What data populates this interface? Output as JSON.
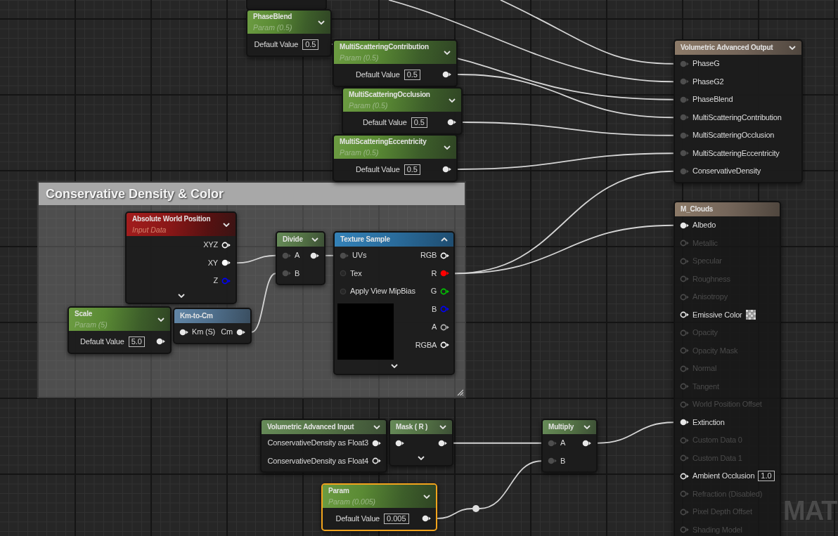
{
  "comment": {
    "title": "Conservative Density & Color"
  },
  "background_label": "MAT",
  "nodes": [
    {
      "kind": "parameter",
      "title": "PhaseBlend",
      "subtitle": "Param (0.5)",
      "selected": false,
      "preview": false,
      "outputs": [
        {
          "label": "Default Value",
          "value": "0.5"
        }
      ]
    },
    {
      "kind": "parameter",
      "title": "MultiScatteringContribution",
      "subtitle": "Param (0.5)",
      "selected": false,
      "preview": false,
      "outputs": [
        {
          "label": "Default Value",
          "value": "0.5",
          "kind": "filled"
        }
      ]
    },
    {
      "kind": "parameter",
      "title": "MultiScatteringOcclusion",
      "subtitle": "Param (0.5)",
      "selected": false,
      "preview": false,
      "outputs": [
        {
          "label": "Default Value",
          "value": "0.5",
          "kind": "filled"
        }
      ]
    },
    {
      "kind": "parameter",
      "title": "MultiScatteringEccentricity",
      "subtitle": "Param (0.5)",
      "selected": false,
      "preview": false,
      "outputs": [
        {
          "label": "Default Value",
          "value": "0.5",
          "kind": "filled"
        }
      ]
    },
    {
      "kind": "output",
      "title": "Volumetric Advanced Output",
      "selected": false,
      "preview": false,
      "inputs": [
        {
          "label": "PhaseG",
          "kind": "dim"
        },
        {
          "label": "PhaseG2",
          "kind": "dim"
        },
        {
          "label": "PhaseBlend",
          "kind": "dim"
        },
        {
          "label": "MultiScatteringContribution",
          "kind": "dim"
        },
        {
          "label": "MultiScatteringOcclusion",
          "kind": "dim"
        },
        {
          "label": "MultiScatteringEccentricity",
          "kind": "dim"
        },
        {
          "label": "ConservativeDensity",
          "kind": "dim"
        }
      ]
    },
    {
      "kind": "input_data",
      "title": "Absolute World Position",
      "subtitle": "Input Data",
      "selected": false,
      "preview": false,
      "expander": true,
      "outputs": [
        {
          "label": "XYZ",
          "kind": "hollow",
          "color": "#ffffff"
        },
        {
          "label": "XY",
          "kind": "filled",
          "color": "#ffffff"
        },
        {
          "label": "Z",
          "kind": "hollow",
          "color": "#0000ff"
        }
      ]
    },
    {
      "kind": "math",
      "title": "Divide",
      "selected": false,
      "preview": false,
      "inputs": [
        {
          "label": "A",
          "kind": "dim"
        },
        {
          "label": "B",
          "kind": "dim"
        }
      ],
      "outputs": [
        {
          "kind": "filled"
        }
      ]
    },
    {
      "kind": "texture",
      "title": "Texture Sample",
      "selected": false,
      "preview": true,
      "expander": true,
      "inputs": [
        {
          "label": "UVs",
          "kind": "dim"
        },
        {
          "label": "Tex",
          "kind": "dark"
        },
        {
          "label": "Apply View MipBias",
          "kind": "dark"
        }
      ],
      "outputs": [
        {
          "label": "RGB",
          "kind": "hollow",
          "color": "#ffffff"
        },
        {
          "label": "R",
          "kind": "filled",
          "color": "#ff0000"
        },
        {
          "label": "G",
          "kind": "hollow",
          "color": "#00c800"
        },
        {
          "label": "B",
          "kind": "hollow",
          "color": "#0000ff"
        },
        {
          "label": "A",
          "kind": "hollow",
          "color": "#b4b4b4"
        },
        {
          "label": "RGBA",
          "kind": "hollow",
          "color": "#ffffff"
        }
      ]
    },
    {
      "kind": "parameter",
      "title": "Scale",
      "subtitle": "Param (5)",
      "selected": false,
      "preview": false,
      "outputs": [
        {
          "label": "Default Value",
          "value": "5.0",
          "kind": "filled"
        }
      ]
    },
    {
      "kind": "function",
      "title": "Km-to-Cm",
      "selected": false,
      "inputs": [
        {
          "label": "Km (S)",
          "kind": "filled"
        }
      ],
      "outputs": [
        {
          "label": "Cm",
          "kind": "filled"
        }
      ]
    },
    {
      "kind": "material",
      "title": "M_Clouds",
      "selected": false,
      "inputs": [
        {
          "label": "Albedo",
          "kind": "filled",
          "disabled": false
        },
        {
          "label": "Metallic",
          "kind": "hollow",
          "disabled": true
        },
        {
          "label": "Specular",
          "kind": "hollow",
          "disabled": true
        },
        {
          "label": "Roughness",
          "kind": "hollow",
          "disabled": true
        },
        {
          "label": "Anisotropy",
          "kind": "hollow",
          "disabled": true
        },
        {
          "label": "Emissive Color",
          "kind": "hollow",
          "disabled": false,
          "swatch": true
        },
        {
          "label": "Opacity",
          "kind": "hollow",
          "disabled": true
        },
        {
          "label": "Opacity Mask",
          "kind": "hollow",
          "disabled": true
        },
        {
          "label": "Normal",
          "kind": "hollow",
          "disabled": true
        },
        {
          "label": "Tangent",
          "kind": "hollow",
          "disabled": true
        },
        {
          "label": "World Position Offset",
          "kind": "hollow",
          "disabled": true
        },
        {
          "label": "Extinction",
          "kind": "filled",
          "disabled": false
        },
        {
          "label": "Custom Data 0",
          "kind": "hollow",
          "disabled": true
        },
        {
          "label": "Custom Data 1",
          "kind": "hollow",
          "disabled": true
        },
        {
          "label": "Ambient Occlusion",
          "value": "1.0",
          "kind": "hollow",
          "disabled": false
        },
        {
          "label": "Refraction (Disabled)",
          "kind": "hollow",
          "disabled": true
        },
        {
          "label": "Pixel Depth Offset",
          "kind": "hollow",
          "disabled": true
        },
        {
          "label": "Shading Model",
          "kind": "hollow",
          "disabled": true
        }
      ]
    },
    {
      "kind": "math",
      "title": "Volumetric Advanced Input",
      "selected": false,
      "preview": false,
      "outputs": [
        {
          "label": "ConservativeDensity as Float3",
          "kind": "filled"
        },
        {
          "label": "ConservativeDensity as Float4",
          "kind": "hollow"
        }
      ]
    },
    {
      "kind": "math",
      "title": "Mask ( R )",
      "selected": false,
      "preview": false,
      "expander": true,
      "inputs": [
        {
          "kind": "filled"
        }
      ],
      "outputs": [
        {
          "kind": "filled"
        }
      ]
    },
    {
      "kind": "math",
      "title": "Multiply",
      "selected": false,
      "preview": false,
      "inputs": [
        {
          "label": "A",
          "kind": "dim"
        },
        {
          "label": "B",
          "kind": "dim"
        }
      ],
      "outputs": [
        {
          "kind": "filled"
        }
      ]
    },
    {
      "kind": "parameter",
      "title": "Param",
      "subtitle": "Param (0.005)",
      "selected": true,
      "preview": false,
      "outputs": [
        {
          "label": "Default Value",
          "value": "0.005",
          "kind": "filled"
        }
      ]
    }
  ]
}
